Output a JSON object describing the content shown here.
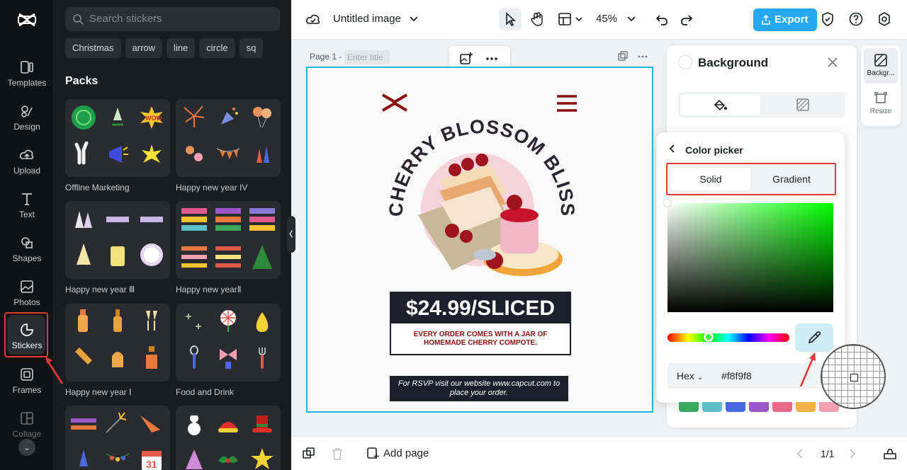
{
  "rail": {
    "items": [
      {
        "label": "Templates",
        "icon": "templates-icon"
      },
      {
        "label": "Design",
        "icon": "design-icon"
      },
      {
        "label": "Upload",
        "icon": "upload-icon"
      },
      {
        "label": "Text",
        "icon": "text-icon"
      },
      {
        "label": "Shapes",
        "icon": "shapes-icon"
      },
      {
        "label": "Photos",
        "icon": "photos-icon"
      },
      {
        "label": "Stickers",
        "icon": "stickers-icon"
      },
      {
        "label": "Frames",
        "icon": "frames-icon"
      },
      {
        "label": "Collage",
        "icon": "collage-icon"
      }
    ],
    "active": "Stickers"
  },
  "panel": {
    "search_placeholder": "Search stickers",
    "chips": [
      "Christmas",
      "arrow",
      "line",
      "circle",
      "sq"
    ],
    "packs_title": "Packs",
    "packs": [
      {
        "name": "Offline Marketing"
      },
      {
        "name": "Happy new year IV"
      },
      {
        "name": "Happy new year Ⅲ"
      },
      {
        "name": "Happy new yearⅡ"
      },
      {
        "name": "Happy new year Ⅰ"
      },
      {
        "name": "Food and Drink"
      }
    ]
  },
  "topbar": {
    "doc_title": "Untitled image",
    "zoom": "45%",
    "export_label": "Export"
  },
  "canvas": {
    "page_label": "Page 1 -",
    "title_placeholder": "Enter title",
    "heading": "CHERRY BLOSSOM BLISS",
    "price": "$24.99/SLICED",
    "price_sub": "EVERY ORDER COMES WITH A JAR OF HOMEMADE CHERRY COMPOTE.",
    "rsvp": "For RSVP visit our website www.capcut.com to place your order."
  },
  "bottombar": {
    "add_page": "Add page",
    "pager": "1/1"
  },
  "background_panel": {
    "title": "Background"
  },
  "color_picker": {
    "title": "Color picker",
    "tabs": [
      "Solid",
      "Gradient"
    ],
    "active_tab": "Solid",
    "hex_mode": "Hex",
    "hex_value": "#f8f9f8",
    "swatches": [
      "#3aa85a",
      "#5bc0c8",
      "#4a68e0",
      "#9a58c8",
      "#e96a8a",
      "#f2b24a",
      "#f0a0b0",
      "#8a7ad8"
    ]
  },
  "right_rail": {
    "items": [
      {
        "label": "Backgr..."
      },
      {
        "label": "Resize"
      }
    ]
  },
  "colors": {
    "accent": "#27a6f2",
    "highlight": "#e53935",
    "canvas_border": "#1fb6d8"
  }
}
